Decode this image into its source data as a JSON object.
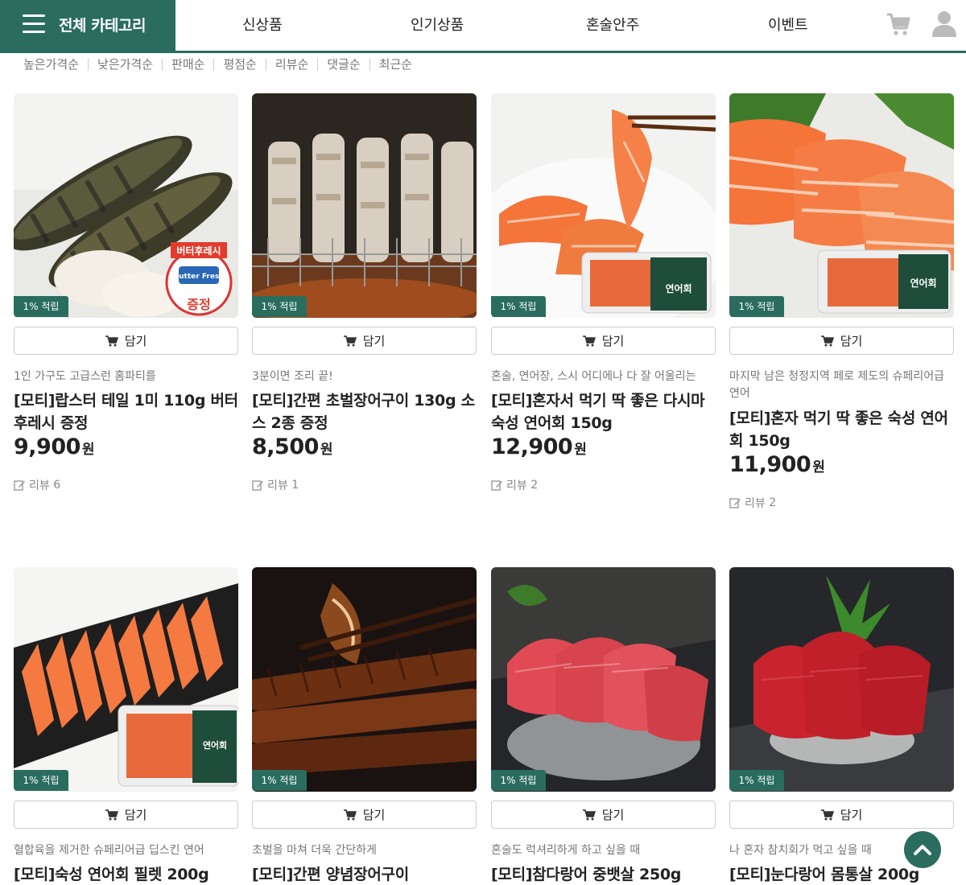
{
  "header": {
    "category_label": "전체 카테고리",
    "nav": [
      "신상품",
      "인기상품",
      "혼술안주",
      "이벤트"
    ]
  },
  "sort_options": [
    "높은가격순",
    "낮은가격순",
    "판매순",
    "평점순",
    "리뷰순",
    "댓글순",
    "최근순"
  ],
  "add_label": "담기",
  "badge_label": "1% 적립",
  "currency": "원",
  "review_label": "리뷰",
  "products": [
    {
      "desc": "1인 가구도 고급스런 홈파티를",
      "name": "[모티]랍스터 테일 1미 110g 버터후레시 증정",
      "price": "9,900",
      "reviews": "6"
    },
    {
      "desc": "3분이면 조리 끝!",
      "name": "[모티]간편 초벌장어구이 130g 소스 2종 증정",
      "price": "8,500",
      "reviews": "1"
    },
    {
      "desc": "혼술, 연어장, 스시 어디에나 다 잘 어울리는",
      "name": "[모티]혼자서 먹기 딱 좋은 다시마 숙성 연어회 150g",
      "price": "12,900",
      "reviews": "2"
    },
    {
      "desc": "마지막 남은 청정지역 페로 제도의 슈페리어급 연어",
      "name": "[모티]혼자 먹기 딱 좋은 숙성 연어회 150g",
      "price": "11,900",
      "reviews": "2"
    },
    {
      "desc": "혈합육을 제거한 슈페리어급 딥스킨 연어",
      "name": "[모티]숙성 연어회 필렛 200g"
    },
    {
      "desc": "초벌을 마쳐 더욱 간단하게",
      "name": "[모티]간편 양념장어구이"
    },
    {
      "desc": "혼술도 럭셔리하게 하고 싶을 때",
      "name": "[모티]참다랑어 중뱃살 250g"
    },
    {
      "desc": "나 혼자 참치회가 먹고 싶을 때",
      "name": "[모티]눈다랑어 몸통살 200g"
    }
  ],
  "product_image_labels": {
    "lobster_sticker": "버터후레시",
    "lobster_butter": "Butter Fresh",
    "lobster_gift": "증정",
    "salmon_pack": "연어회"
  },
  "colors": {
    "brand": "#2a6d5f"
  }
}
